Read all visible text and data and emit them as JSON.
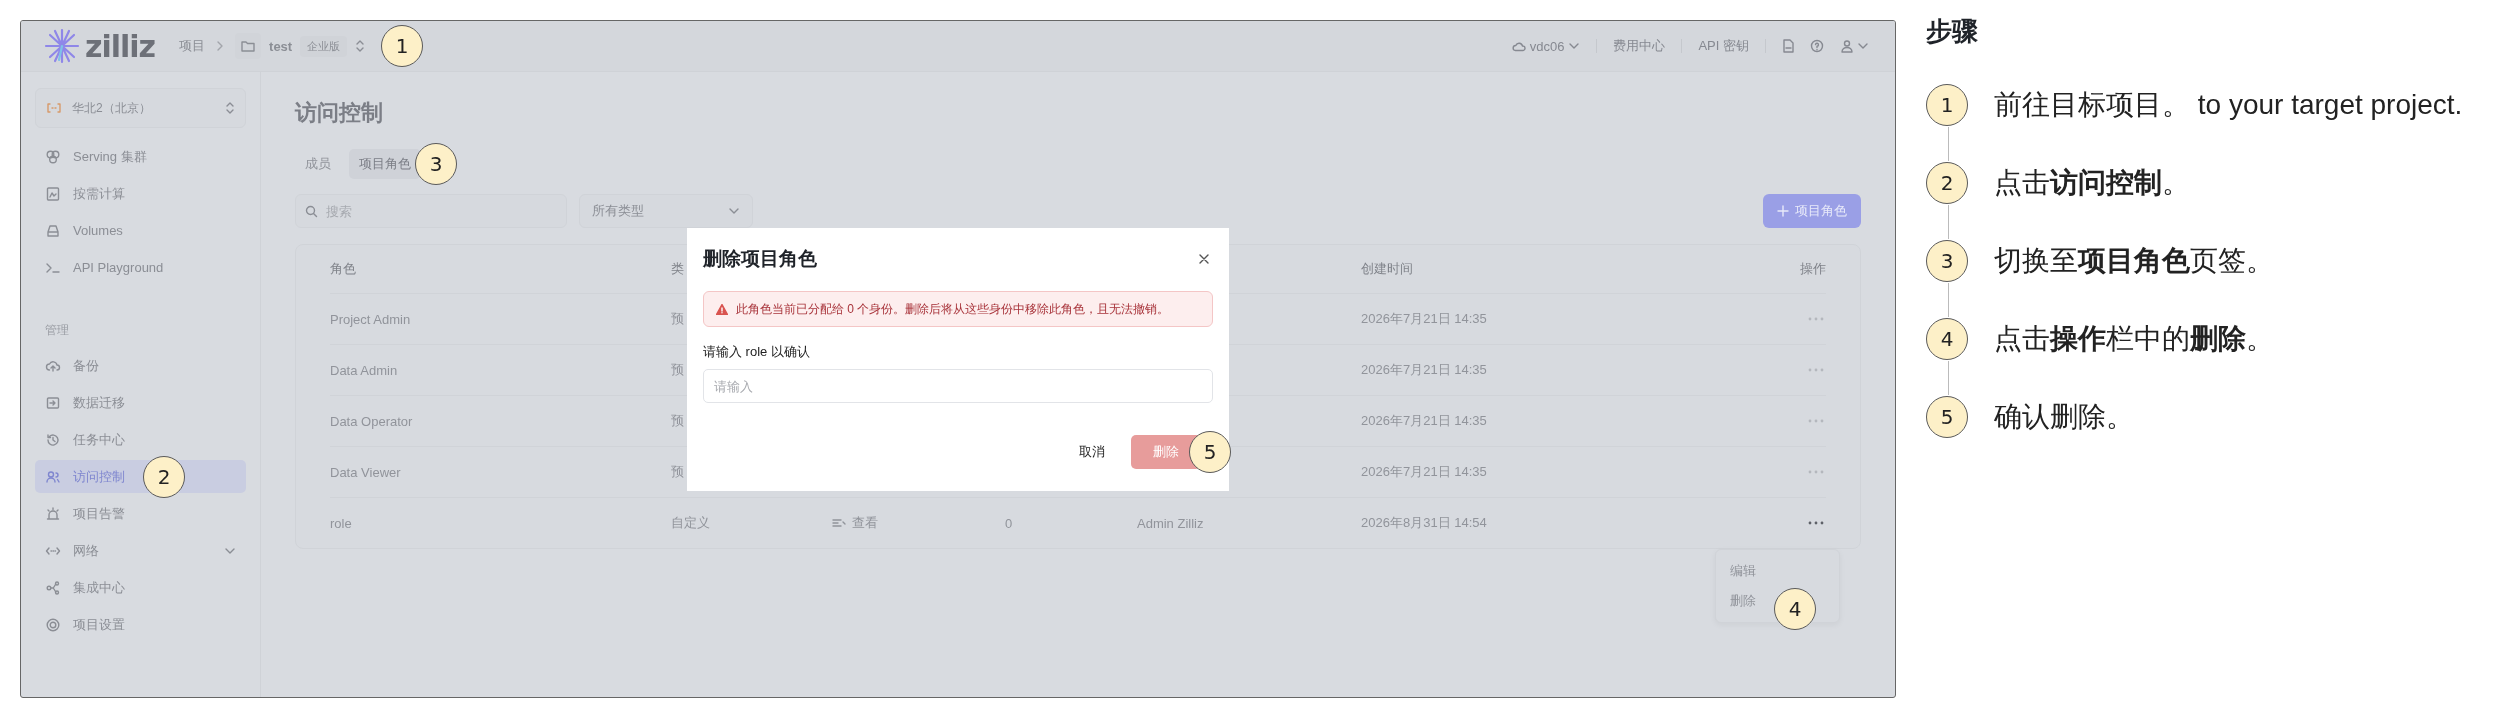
{
  "header": {
    "logo": "zilliz",
    "breadcrumb_root": "项目",
    "project": "test",
    "edition": "企业版",
    "marker": "1",
    "org": "vdc06",
    "links": [
      "费用中心",
      "API 密钥"
    ]
  },
  "sidebar": {
    "region": "华北2（北京）",
    "items": [
      {
        "label": "Serving 集群",
        "selected": false
      },
      {
        "label": "按需计算",
        "selected": false
      },
      {
        "label": "Volumes",
        "selected": false
      },
      {
        "label": "API Playground",
        "selected": false
      }
    ],
    "section": "管理",
    "section_items": [
      {
        "label": "备份",
        "selected": false
      },
      {
        "label": "数据迁移",
        "selected": false
      },
      {
        "label": "任务中心",
        "selected": false
      },
      {
        "label": "访问控制",
        "selected": true,
        "marker": "2"
      },
      {
        "label": "项目告警",
        "selected": false
      },
      {
        "label": "网络",
        "selected": false,
        "expandable": true
      },
      {
        "label": "集成中心",
        "selected": false
      },
      {
        "label": "项目设置",
        "selected": false
      }
    ]
  },
  "page": {
    "title": "访问控制",
    "tabs": [
      {
        "label": "成员",
        "selected": false
      },
      {
        "label": "项目角色",
        "selected": true,
        "marker": "3"
      }
    ],
    "search": {
      "placeholder": "搜索"
    },
    "type_filter": "所有类型",
    "add_button": "项目角色",
    "table": {
      "columns": [
        {
          "label": "角色",
          "kind": "text"
        },
        {
          "label": "类",
          "kind": "text"
        },
        {
          "label": "创建时间",
          "kind": "time"
        },
        {
          "label": "操作",
          "kind": "actions"
        }
      ],
      "rows": [
        {
          "role": "Project Admin",
          "type": "预",
          "created": "2026年7月21日 14:35",
          "menu_open": false
        },
        {
          "role": "Data Admin",
          "type": "预",
          "created": "2026年7月21日 14:35",
          "menu_open": false
        },
        {
          "role": "Data Operator",
          "type": "预",
          "created": "2026年7月21日 14:35",
          "menu_open": false
        },
        {
          "role": "Data Viewer",
          "type": "预",
          "created": "2026年7月21日 14:35",
          "menu_open": false
        },
        {
          "role": "role",
          "type": "自定义",
          "permissions": "查看",
          "identities": "0",
          "creator": "Admin Zilliz",
          "created": "2026年8月31日 14:54",
          "menu_open": true
        }
      ]
    },
    "action_menu": {
      "items": [
        {
          "label": "编辑"
        },
        {
          "label": "删除",
          "marker": "4"
        }
      ]
    }
  },
  "dialog": {
    "title": "删除项目角色",
    "warning": "此角色当前已分配给 0 个身份。删除后将从这些身份中移除此角色，且无法撤销。",
    "prompt": "请输入 role 以确认",
    "placeholder": "请输入",
    "cancel": "取消",
    "confirm": {
      "label": "删除",
      "disabled": true,
      "marker": "5"
    }
  },
  "steps": {
    "title": "步骤",
    "items": [
      {
        "number": "1",
        "text": "前往目标项目。 to your target project."
      },
      {
        "number": "2",
        "text": "点击**访问控制**。"
      },
      {
        "number": "3",
        "text": "切换至**项目角色**页签。"
      },
      {
        "number": "4",
        "text": "点击**操作**栏中的**删除**。"
      },
      {
        "number": "5",
        "text": "确认删除。"
      }
    ]
  }
}
